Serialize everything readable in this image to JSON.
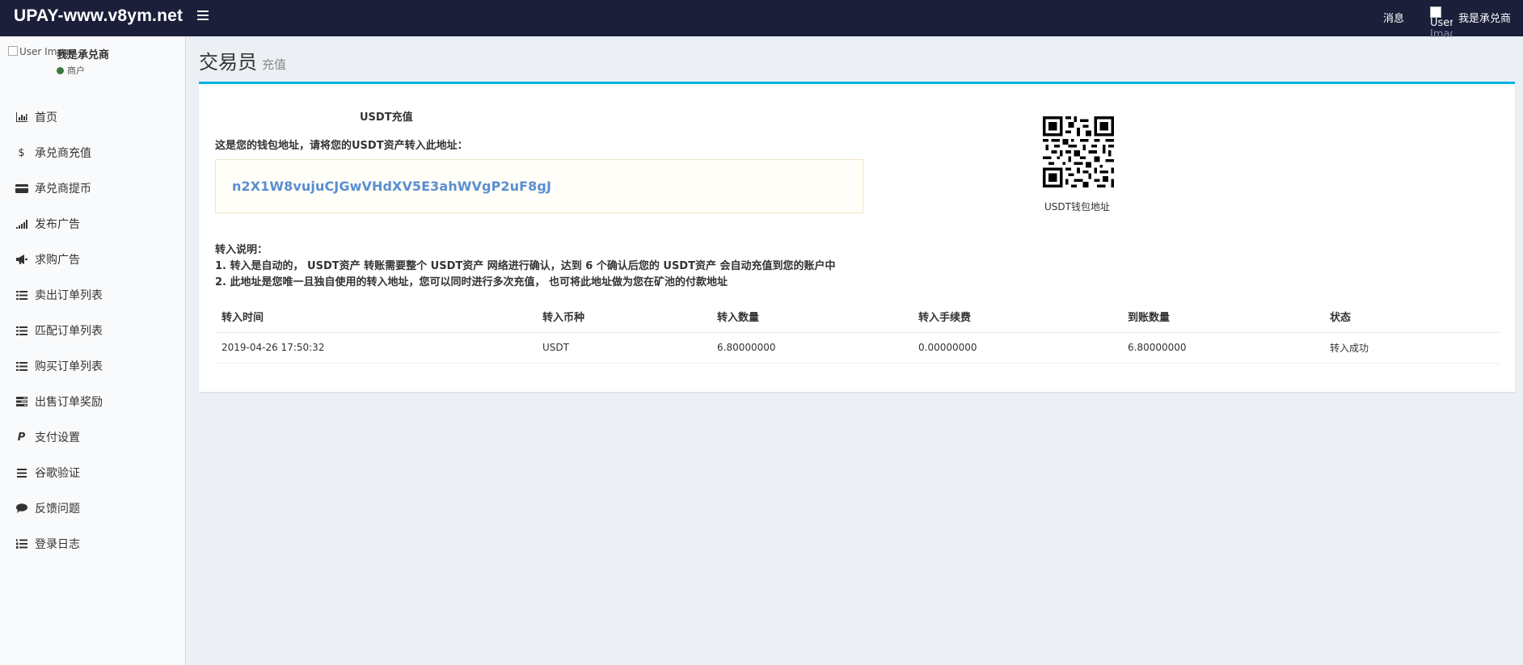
{
  "header": {
    "brand": "UPAY-www.v8ym.net",
    "messages_label": "消息",
    "user_image_alt_line1": "User",
    "user_image_alt_line2": "Image",
    "user_name": "我是承兑商"
  },
  "sidebar": {
    "user_image_alt": "User Image",
    "user_name": "我是承兑商",
    "user_status": "商户",
    "status_color": "#3c763d",
    "items": [
      {
        "label": "首页",
        "icon": "bar-chart-icon"
      },
      {
        "label": "承兑商充值",
        "icon": "dollar-icon"
      },
      {
        "label": "承兑商提币",
        "icon": "credit-card-icon"
      },
      {
        "label": "发布广告",
        "icon": "signal-icon"
      },
      {
        "label": "求购广告",
        "icon": "bullhorn-icon"
      },
      {
        "label": "卖出订单列表",
        "icon": "list-icon"
      },
      {
        "label": "匹配订单列表",
        "icon": "list-icon"
      },
      {
        "label": "购买订单列表",
        "icon": "list-icon"
      },
      {
        "label": "出售订单奖励",
        "icon": "tasks-icon"
      },
      {
        "label": "支付设置",
        "icon": "paypal-icon"
      },
      {
        "label": "谷歌验证",
        "icon": "bars-icon"
      },
      {
        "label": "反馈问题",
        "icon": "comment-icon"
      },
      {
        "label": "登录日志",
        "icon": "list-ol-icon"
      }
    ]
  },
  "content": {
    "title": "交易员",
    "subtitle": "充值"
  },
  "recharge": {
    "title": "USDT充值",
    "wallet_hint": "这是您的钱包地址，请将您的USDT资产转入此地址：",
    "address": "n2X1W8vujuCJGwVHdXV5E3ahWVgP2uF8gJ",
    "qr_label": "USDT钱包地址",
    "notes_title": "转入说明：",
    "note1": "1. 转入是自动的， USDT资产 转账需要整个 USDT资产 网络进行确认，达到 6 个确认后您的 USDT资产 会自动充值到您的账户中",
    "note2": "2. 此地址是您唯一且独自使用的转入地址，您可以同时进行多次充值， 也可将此地址做为您在矿池的付款地址"
  },
  "table": {
    "headers": [
      "转入时间",
      "转入币种",
      "转入数量",
      "转入手续费",
      "到账数量",
      "状态"
    ],
    "rows": [
      [
        "2019-04-26 17:50:32",
        "USDT",
        "6.80000000",
        "0.00000000",
        "6.80000000",
        "转入成功"
      ]
    ]
  },
  "colors": {
    "topbar": "#1b1f3a",
    "box_accent": "#00b2e2",
    "address_text": "#5a8ed0"
  }
}
